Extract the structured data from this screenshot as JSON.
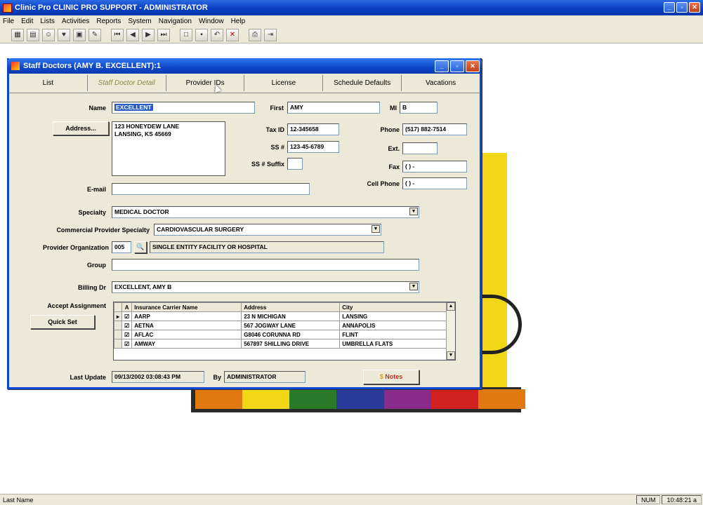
{
  "app": {
    "title": "Clinic Pro CLINIC PRO SUPPORT - ADMINISTRATOR",
    "menu": [
      "File",
      "Edit",
      "Lists",
      "Activities",
      "Reports",
      "System",
      "Navigation",
      "Window",
      "Help"
    ],
    "toolbar_icons": [
      "chart-icon",
      "calendar-icon",
      "patient-icon",
      "heart-icon",
      "document-icon",
      "notepad-icon",
      "first-record-icon",
      "previous-record-icon",
      "next-record-icon",
      "last-record-icon",
      "new-record-icon",
      "save-icon",
      "undo-icon",
      "delete-icon",
      "print-icon",
      "exit-icon"
    ]
  },
  "window": {
    "title": "Staff Doctors (AMY B. EXCELLENT):1",
    "tabs": [
      "List",
      "Staff Doctor Detail",
      "Provider IDs",
      "License",
      "Schedule Defaults",
      "Vacations"
    ]
  },
  "form": {
    "name_label": "Name",
    "name_value": "EXCELLENT",
    "first_label": "First",
    "first_value": "AMY",
    "mi_label": "MI",
    "mi_value": "B",
    "address_button": "Address...",
    "address_line1": "123 HONEYDEW LANE",
    "address_line2": "LANSING, KS 45669",
    "taxid_label": "Tax ID",
    "taxid_value": "12-345658",
    "ssn_label": "SS #",
    "ssn_value": "123-45-6789",
    "ssn_suffix_label": "SS # Suffix",
    "ssn_suffix_value": "",
    "phone_label": "Phone",
    "phone_value": "(517) 882-7514",
    "ext_label": "Ext.",
    "ext_value": "",
    "fax_label": "Fax",
    "fax_value": "(  )   -",
    "cell_label": "Cell Phone",
    "cell_value": "(  )   -",
    "email_label": "E-mail",
    "email_value": "",
    "specialty_label": "Specialty",
    "specialty_value": "MEDICAL DOCTOR",
    "commercial_label": "Commercial Provider Specialty",
    "commercial_value": "CARDIOVASCULAR SURGERY",
    "org_label": "Provider Organization",
    "org_code": "005",
    "org_name": "SINGLE ENTITY FACILITY OR HOSPITAL",
    "group_label": "Group",
    "group_value": "",
    "billing_label": "Billing Dr",
    "billing_value": "EXCELLENT, AMY B",
    "accept_label": "Accept Assignment",
    "quickset_button": "Quick Set",
    "last_update_label": "Last Update",
    "last_update_value": "09/13/2002 03:08:43 PM",
    "by_label": "By",
    "by_value": "ADMINISTRATOR",
    "notes_button": "Notes"
  },
  "grid": {
    "headers": [
      "A",
      "Insurance Carrier Name",
      "Address",
      "City"
    ],
    "rows": [
      {
        "checked": true,
        "name": "AARP",
        "address": "23 N MICHIGAN",
        "city": "LANSING"
      },
      {
        "checked": true,
        "name": "AETNA",
        "address": "567 JOGWAY LANE",
        "city": "ANNAPOLIS"
      },
      {
        "checked": true,
        "name": "AFLAC",
        "address": "G8046 CORUNNA RD",
        "city": "FLINT"
      },
      {
        "checked": true,
        "name": "AMWAY",
        "address": "567897 SHILLING DRIVE",
        "city": "UMBRELLA FLATS"
      }
    ]
  },
  "statusbar": {
    "left": "Last Name",
    "num": "NUM",
    "time": "10:48:21 a"
  },
  "colors": {
    "title_blue": "#0a47d8",
    "logo_yellow": "#f2d618",
    "color_bar": [
      "#e07a10",
      "#f2d618",
      "#2a7a2a",
      "#2b3a9a",
      "#8a2a8a",
      "#d02020",
      "#e07a10"
    ]
  }
}
